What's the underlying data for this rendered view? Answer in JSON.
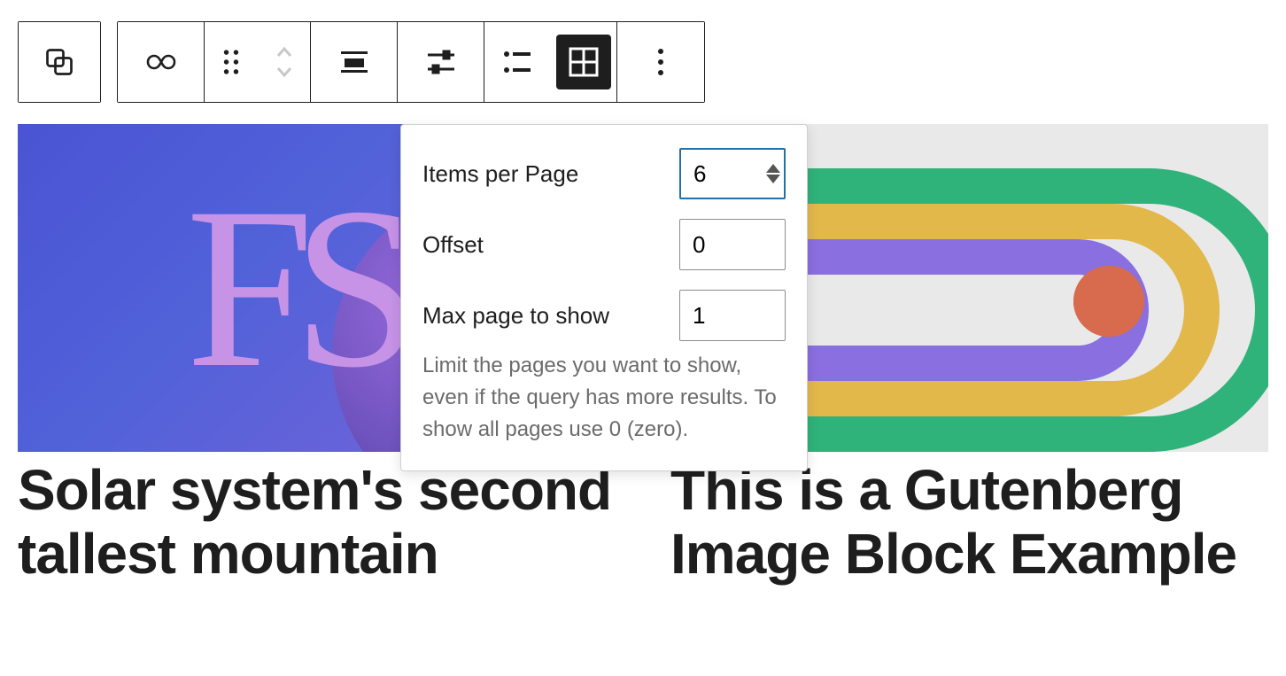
{
  "toolbar": {
    "block_type_label": "Query Loop",
    "pattern_label": "Choose pattern",
    "drag_label": "Drag",
    "move_label": "Move up/down",
    "align_label": "Align",
    "display_settings_label": "Display settings",
    "list_view_label": "List view",
    "grid_view_label": "Grid view",
    "options_label": "Options"
  },
  "popover": {
    "items_per_page": {
      "label": "Items per Page",
      "value": "6"
    },
    "offset": {
      "label": "Offset",
      "value": "0"
    },
    "max_page": {
      "label": "Max page to show",
      "value": "1"
    },
    "help_text": "Limit the pages you want to show, even if the query has more results. To show all pages use 0 (zero)."
  },
  "posts": [
    {
      "title": "Solar system's second tallest mountain",
      "thumb_alt": "FS purple gradient artwork"
    },
    {
      "title": "This is a Gutenberg Image Block Example",
      "thumb_alt": "Rainbow arc geometric artwork"
    }
  ]
}
